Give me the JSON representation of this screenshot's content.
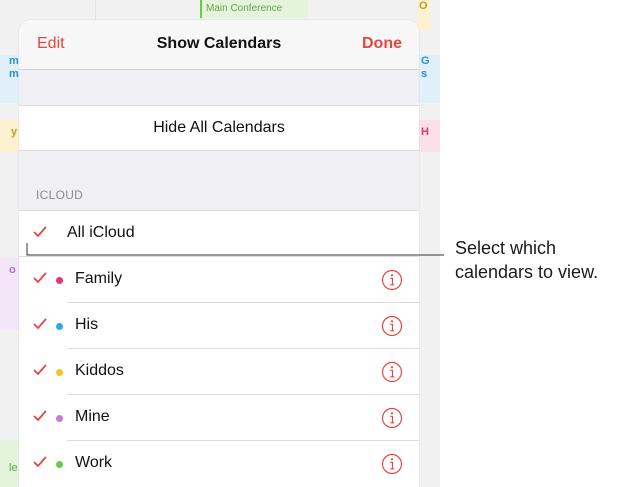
{
  "colors": {
    "accent": "#e5463f",
    "family": "#e8336d",
    "his": "#2fa7e6",
    "kiddos": "#f5c51d",
    "mine": "#c77ad9",
    "work": "#6ac94a"
  },
  "background_calendar": {
    "event_top": "Main Conference",
    "left_col_fragments": [
      "m",
      "m",
      "y",
      "o",
      "le"
    ],
    "right_col_fragments": [
      "O",
      "G",
      "s",
      "H"
    ]
  },
  "nav": {
    "edit_label": "Edit",
    "title": "Show Calendars",
    "done_label": "Done"
  },
  "hide_all_label": "Hide All Calendars",
  "section_header": "ICLOUD",
  "calendars": [
    {
      "label": "All iCloud",
      "checked": true,
      "icon": "checkmark-icon"
    },
    {
      "label": "Family",
      "checked": true,
      "icon": "info-icon"
    },
    {
      "label": "His",
      "checked": true,
      "icon": "info-icon"
    },
    {
      "label": "Kiddos",
      "checked": true,
      "icon": "info-icon"
    },
    {
      "label": "Mine",
      "checked": true,
      "icon": "info-icon"
    },
    {
      "label": "Work",
      "checked": true,
      "icon": "info-icon"
    }
  ],
  "callout": {
    "line1": "Select which",
    "line2": "calendars to view."
  }
}
